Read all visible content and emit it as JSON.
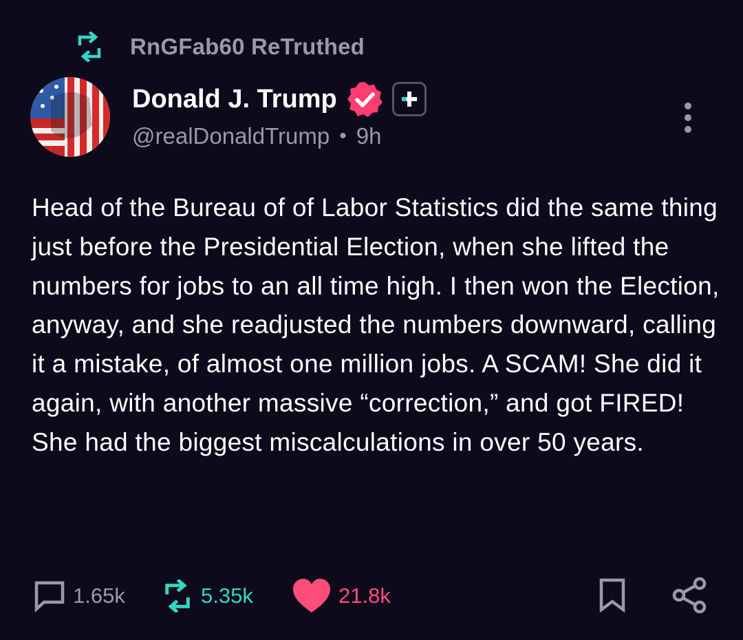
{
  "retruth": {
    "icon": "retruth-icon",
    "text": "RnGFab60 ReTruthed"
  },
  "post": {
    "author_name": "Donald J. Trump",
    "handle": "@realDonaldTrump",
    "separator": "•",
    "time": "9h",
    "verified_icon": "verified-badge-icon",
    "plus_badge_icon": "plus-badge-icon",
    "more_icon": "more-vertical-icon",
    "body": "Head of the Bureau of of Labor Statistics did the same thing just before the Presidential Election, when she lifted the numbers for jobs to an all time high. I then won the Election, anyway, and she readjusted the numbers downward, calling it a mistake, of almost one million jobs. A SCAM! She did it again, with another massive “correction,” and got FIRED! She had the biggest miscalculations in over 50 years."
  },
  "actions": {
    "reply_count": "1.65k",
    "retruth_count": "5.35k",
    "like_count": "21.8k",
    "bookmark_icon": "bookmark-icon",
    "share_icon": "share-icon"
  },
  "colors": {
    "background": "#0d0a1c",
    "text_primary": "#ffffff",
    "text_secondary": "#9a9aa6",
    "retruth_teal": "#35d6c4",
    "like_pink": "#ff4d7a",
    "verified_pink": "#ff3d6e"
  }
}
